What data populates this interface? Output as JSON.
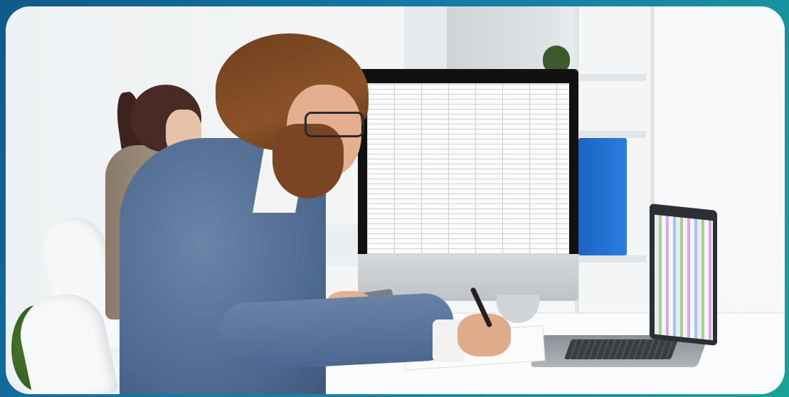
{
  "scene": {
    "description_tags": [
      "office",
      "accountant",
      "spreadsheet",
      "monitor",
      "laptop"
    ],
    "colors": {
      "border_gradient_start": "#0e5a8a",
      "border_gradient_end": "#1aa39a",
      "blazer": "#4f6a90",
      "hair": "#8b5228",
      "binder": "#1a63c2"
    }
  }
}
